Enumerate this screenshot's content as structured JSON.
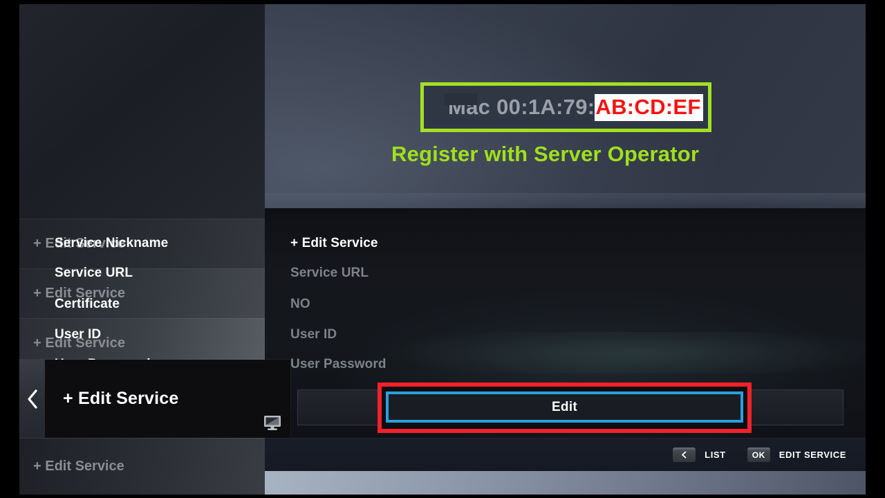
{
  "sidebar": {
    "items": [
      {
        "label": "+ Edit Service"
      },
      {
        "label": "+ Edit Service"
      },
      {
        "label": "+ Edit Service"
      },
      {
        "label": "+ Edit Service"
      }
    ],
    "selected": {
      "label": "+ Edit Service",
      "back_icon": "chevron-left-icon",
      "device_icon": "monitor-icon"
    }
  },
  "hero": {
    "mac_label_prefix": "Mac 00:1A:79:",
    "mac_label_suffix": "AB:CD:EF",
    "annotation": "Register with Server Operator",
    "highlight_color": "#a3e024",
    "mac_suffix_color": "#f51313"
  },
  "form": {
    "rows": [
      {
        "key": "Service Nickname",
        "value": "+ Edit Service",
        "filled": true
      },
      {
        "key": "Service URL",
        "value": "Service URL",
        "filled": false
      },
      {
        "key": "Certificate",
        "value": "NO",
        "filled": false
      },
      {
        "key": "User ID",
        "value": "User ID",
        "filled": false
      },
      {
        "key": "User Password",
        "value": "User Password",
        "filled": false
      }
    ],
    "submit": {
      "label": "Edit",
      "focus_color": "#2a9fe0",
      "callout_color": "#f2212b"
    }
  },
  "footer": {
    "hints": [
      {
        "key": "<",
        "label": "LIST",
        "icon": "chevron-left-icon"
      },
      {
        "key": "OK",
        "label": "EDIT SERVICE"
      }
    ]
  }
}
